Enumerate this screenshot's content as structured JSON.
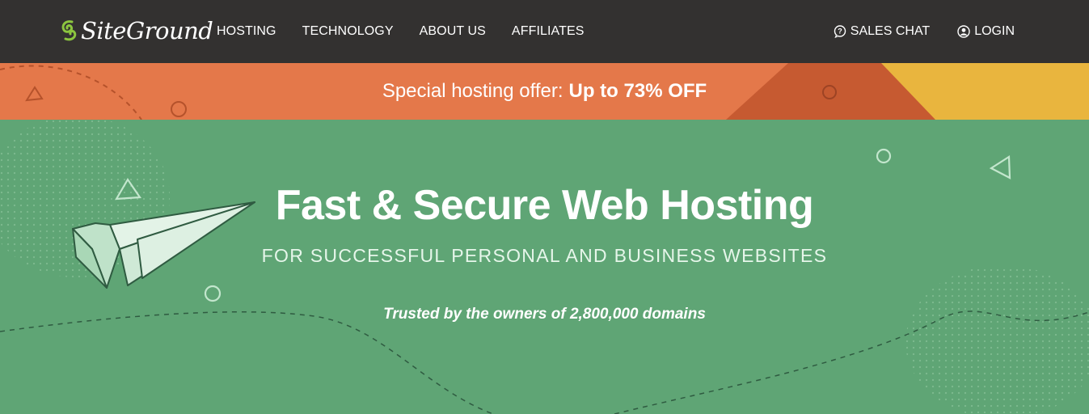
{
  "header": {
    "logo_text": "SiteGround",
    "nav": [
      "HOSTING",
      "TECHNOLOGY",
      "ABOUT US",
      "AFFILIATES"
    ],
    "sales_chat": "SALES CHAT",
    "login": "LOGIN"
  },
  "offer": {
    "prefix": "Special hosting offer:",
    "highlight": "Up to 73% OFF"
  },
  "hero": {
    "title": "Fast & Secure Web Hosting",
    "subtitle": "FOR SUCCESSFUL PERSONAL AND BUSINESS WEBSITES",
    "trusted": "Trusted by the owners of 2,800,000 domains"
  },
  "colors": {
    "topbar": "#333130",
    "offer_orange": "#e4784a",
    "offer_dark": "#c65a31",
    "offer_yellow": "#e9b53e",
    "hero_green": "#5fa575",
    "logo_green": "#8cc63f"
  },
  "icons": [
    "siteground-logo-icon",
    "question-chat-icon",
    "user-icon",
    "paper-plane-icon"
  ]
}
